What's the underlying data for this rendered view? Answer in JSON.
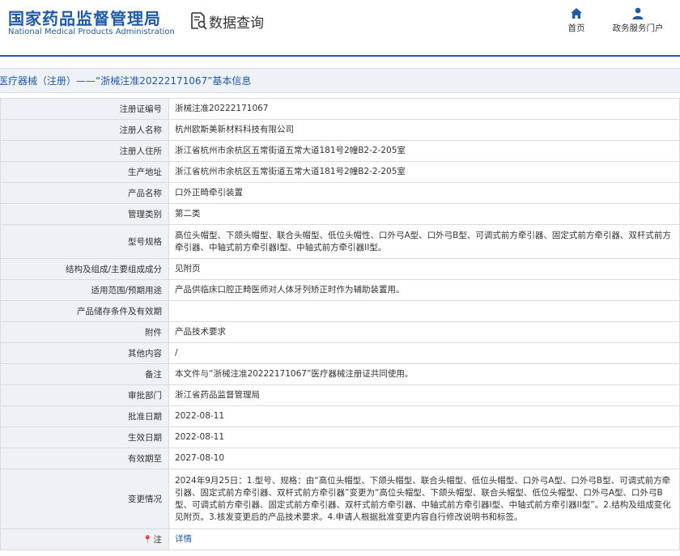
{
  "header": {
    "logo_cn": "国家药品监督管理局",
    "logo_en": "National Medical Products Administration",
    "page_title": "数据查询",
    "nav": [
      {
        "label": "首页",
        "icon": "home-icon"
      },
      {
        "label": "政务服务门户",
        "icon": "user-icon"
      }
    ]
  },
  "colors": {
    "brand": "#1f5aa8",
    "label_bg": "#eef1f5",
    "border": "#d7dce3"
  },
  "section_title": "医疗器械（注册）——“浙械注准20222171067”基本信息",
  "rows": [
    {
      "label": "注册证编号",
      "value": "浙械注准20222171067"
    },
    {
      "label": "注册人名称",
      "value": "杭州欧斯美新材料科技有限公司"
    },
    {
      "label": "注册人住所",
      "value": "浙江省杭州市余杭区五常街道五常大道181号2幢B2-2-205室"
    },
    {
      "label": "生产地址",
      "value": "浙江省杭州市余杭区五常街道五常大道181号2幢B2-2-205室"
    },
    {
      "label": "产品名称",
      "value": "口外正畸牵引装置"
    },
    {
      "label": "管理类别",
      "value": "第二类"
    },
    {
      "label": "型号规格",
      "value": "高位头帽型、下颌头帽型、联合头帽型、低位头帽性、口外弓A型、口外弓B型、可调式前方牵引器、固定式前方牵引器、双杆式前方牵引器、中轴式前方牵引器I型、中轴式前方牵引器II型。"
    },
    {
      "label": "结构及组成/主要组成成分",
      "value": "见附页"
    },
    {
      "label": "适用范围/预期用途",
      "value": "产品供临床口腔正畸医师对人体牙列矫正时作为辅助装置用。"
    },
    {
      "label": "产品储存条件及有效期",
      "value": ""
    },
    {
      "label": "附件",
      "value": "产品技术要求"
    },
    {
      "label": "其他内容",
      "value": "/"
    },
    {
      "label": "备注",
      "value": "本文件与“浙械注准20222171067”医疗器械注册证共同使用。"
    },
    {
      "label": "审批部门",
      "value": "浙江省药品监督管理局"
    },
    {
      "label": "批准日期",
      "value": "2022-08-11"
    },
    {
      "label": "生效日期",
      "value": "2022-08-11"
    },
    {
      "label": "有效期至",
      "value": "2027-08-10"
    },
    {
      "label": "变更情况",
      "value": "2024年9月25日：1.型号、规格：由“高位头帽型、下颌头帽型、联合头帽型、低位头帽型、口外弓A型、口外弓B型、可调式前方牵引器、固定式前方牵引器、双杆式前方牵引器”变更为“高位头帽型、下颌头帽型、联合头帽型、低位头帽型、口外弓A型、口外弓B型、可调式前方牵引器、固定式前方牵引器、双杆式前方牵引器、中轴式前方牵引器I型、中轴式前方牵引器II型”。2.结构及组成变化见附页。3.核发变更后的产品技术要求。4.申请人根据批准变更内容自行修改说明书和标签。"
    }
  ],
  "note": {
    "label": "注",
    "link": "详情"
  }
}
